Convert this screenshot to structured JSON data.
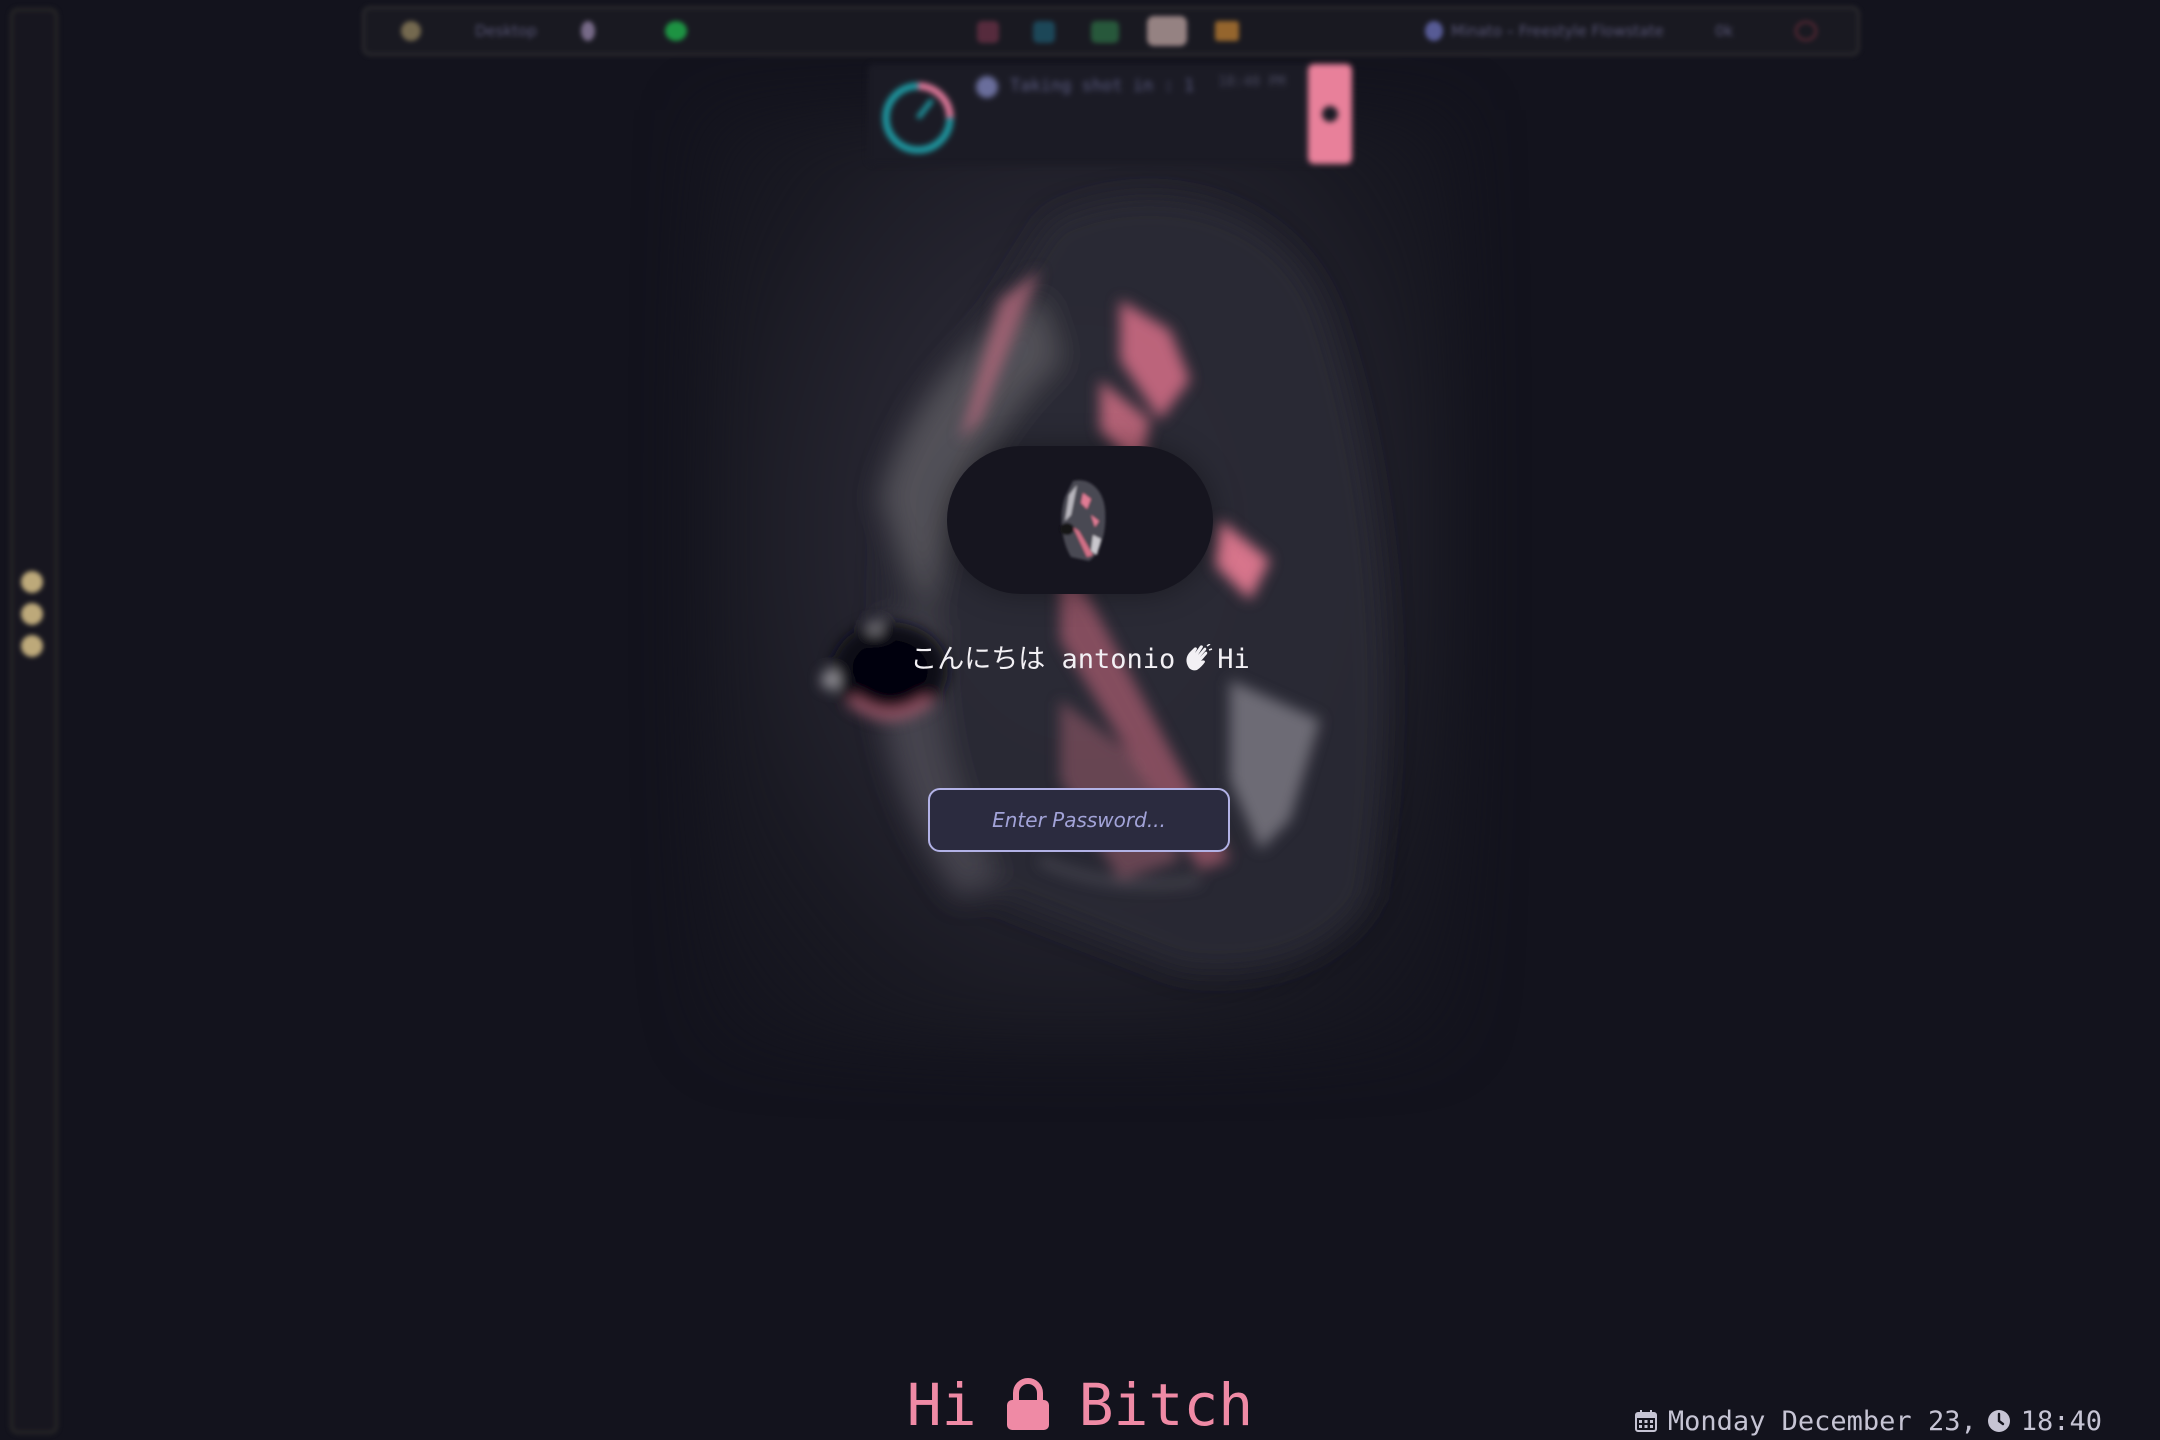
{
  "background": {
    "top_bar": {
      "workspace_label": "Desktop",
      "media_label": "Minato – Freestyle Flowstate",
      "stats_label": "0k"
    },
    "notification": {
      "text": "Taking shot in : 1",
      "time": "18:40 PM"
    }
  },
  "lockscreen": {
    "greeting": "こんにちは antonio",
    "greeting_suffix": "Hi",
    "password_placeholder": "Enter Password...",
    "footer_left": "Hi",
    "footer_right": "Bitch",
    "date": "Monday December 23,",
    "time": "18:40"
  },
  "colors": {
    "accent_pink": "#ef8aa5",
    "field_border": "#b2b2e6",
    "field_bg": "#2b2b3f",
    "background": "#13131d"
  },
  "icons": {
    "wave": "waving-hand-icon",
    "lock": "lock-icon",
    "calendar": "calendar-icon",
    "clock": "clock-icon"
  }
}
